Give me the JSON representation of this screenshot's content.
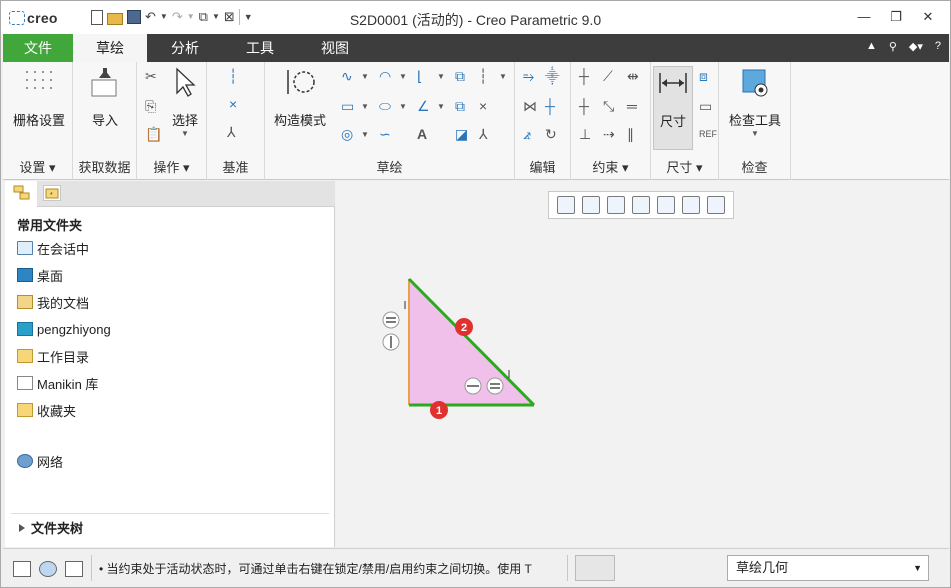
{
  "app": {
    "logo_text": "creo",
    "title": "S2D0001 (活动的) - Creo Parametric 9.0"
  },
  "window_controls": [
    "—",
    "❐",
    "✕"
  ],
  "tabs": [
    {
      "label": "文件"
    },
    {
      "label": "草绘"
    },
    {
      "label": "分析"
    },
    {
      "label": "工具"
    },
    {
      "label": "视图"
    }
  ],
  "ribbon": {
    "setup": {
      "button": "栅格设置",
      "group": "设置"
    },
    "getdata": {
      "button": "导入",
      "group": "获取数据"
    },
    "operations": {
      "button": "选择",
      "group": "操作"
    },
    "datum": {
      "group": "基准"
    },
    "sketch": {
      "button": "构造模式",
      "group": "草绘"
    },
    "edit": {
      "group": "编辑"
    },
    "constrain": {
      "group": "约束"
    },
    "dimension": {
      "button": "尺寸",
      "group": "尺寸"
    },
    "inspect": {
      "button": "检查工具",
      "group": "检查"
    }
  },
  "left_panel": {
    "heading": "常用文件夹",
    "items": [
      {
        "label": "在会话中",
        "icon": "monitor-icon"
      },
      {
        "label": "桌面",
        "icon": "desktop-icon"
      },
      {
        "label": "我的文档",
        "icon": "documents-icon"
      },
      {
        "label": "pengzhiyong",
        "icon": "computer-icon"
      },
      {
        "label": "工作目录",
        "icon": "working-dir-icon"
      },
      {
        "label": "Manikin 库",
        "icon": "library-icon"
      },
      {
        "label": "收藏夹",
        "icon": "favorites-icon"
      }
    ],
    "network": {
      "label": "网络"
    },
    "folder_tree": {
      "label": "文件夹树"
    }
  },
  "sketch": {
    "fill_color": "#f0c0ea",
    "line_color": "#2aaa1e",
    "markers": [
      "1",
      "2"
    ]
  },
  "status": {
    "message": "• 当约束处于活动状态时，可通过单击右键在锁定/禁用/启用约束之间切换。使用 T",
    "filter": "草绘几何"
  }
}
